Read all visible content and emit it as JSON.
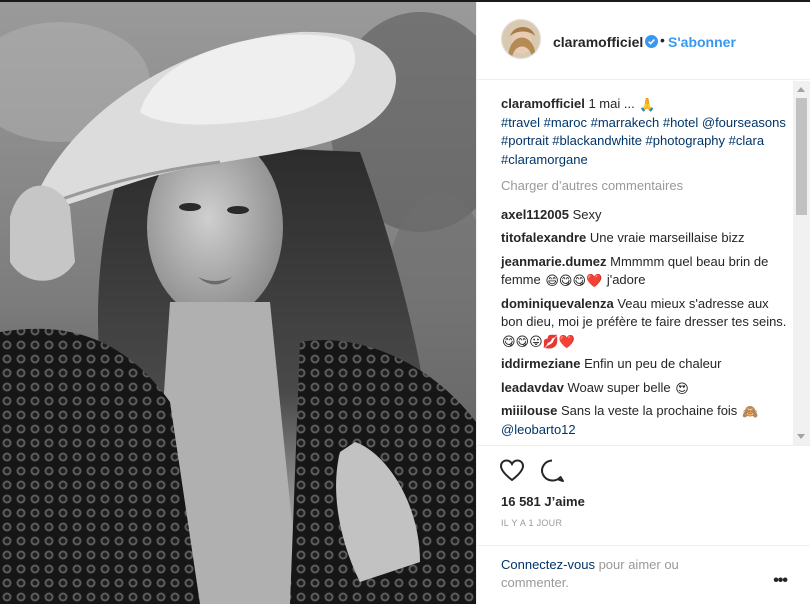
{
  "post": {
    "username": "claramofficiel",
    "follow_label": "S'abonner",
    "separator": "•",
    "caption_text": "1 mai ...",
    "caption_emoji": "🙏",
    "hashtags": "#travel #maroc #marrakech #hotel @fourseasons #portrait #blackandwhite #photography #clara #claramorgane",
    "load_more_label": "Charger d’autres commentaires",
    "likes": "16 581 J’aime",
    "time_ago": "IL Y A 1 JOUR",
    "login_link": "Connectez-vous",
    "login_suffix": " pour aimer ou commenter.",
    "more_label": "•••"
  },
  "comments": [
    {
      "user": "axel112005",
      "text": "Sexy"
    },
    {
      "user": "titofalexandre",
      "text": "Une vraie marseillaise bizz"
    },
    {
      "user": "jeanmarie.dumez",
      "text": "Mmmmm quel beau brin de femme",
      "emoji1": "😄😋😋❤️",
      "text2": "j'adore"
    },
    {
      "user": "dominiquevalenza",
      "text": "Veau mieux s'adresse aux bon dieu, moi je préfère te faire dresser tes seins.",
      "emoji1": "😋😋😛💋❤️"
    },
    {
      "user": "iddirmeziane",
      "text": "Enfin un peu de chaleur"
    },
    {
      "user": "leadavdav",
      "text": "Woaw super belle",
      "emoji1": "😍"
    },
    {
      "user": "miiilouse",
      "text": "Sans la veste la prochaine fois",
      "emoji1": "🙈",
      "mention": "@leobarto12"
    }
  ],
  "icons": {
    "heart": "heart-icon",
    "comment": "comment-icon",
    "verified": "verified-badge-icon"
  },
  "colors": {
    "accent": "#3897f0",
    "link": "#003569",
    "muted": "#999999",
    "text": "#262626"
  }
}
